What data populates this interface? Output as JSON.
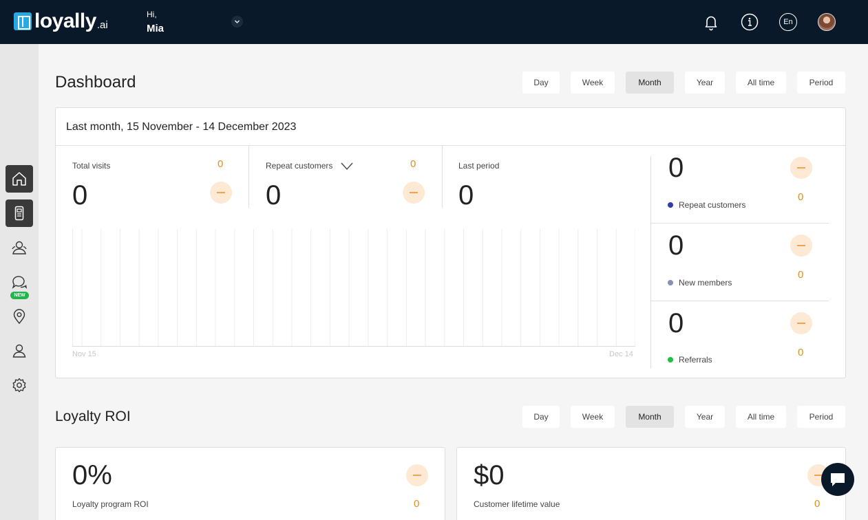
{
  "header": {
    "logo_text": "loyally",
    "logo_suffix": ".ai",
    "greeting": "Hi,",
    "user_name": "Mia",
    "language": "En",
    "icons": [
      "bell-icon",
      "info-icon",
      "chevron-down-icon"
    ]
  },
  "sidebar": {
    "items": [
      {
        "icon": "home-icon",
        "active": true
      },
      {
        "icon": "device-icon",
        "active": true
      },
      {
        "icon": "customers-icon",
        "active": false
      },
      {
        "icon": "chat-icon",
        "active": false,
        "badge": "NEW"
      },
      {
        "icon": "location-pin-icon",
        "active": false
      },
      {
        "icon": "user-icon",
        "active": false
      },
      {
        "icon": "gear-icon",
        "active": false
      }
    ]
  },
  "dashboard": {
    "title": "Dashboard",
    "periods": [
      "Day",
      "Week",
      "Month",
      "Year",
      "All time",
      "Period"
    ],
    "selected_period": "Month",
    "range_title": "Last month, 15 November - 14 December 2023",
    "metrics": {
      "total_visits": {
        "label": "Total visits",
        "value": "0",
        "delta": "0"
      },
      "repeat_customers": {
        "label": "Repeat customers",
        "value": "0",
        "delta": "0"
      },
      "last_period": {
        "label": "Last period",
        "value": "0"
      }
    },
    "side_stats": [
      {
        "label": "Repeat customers",
        "value": "0",
        "delta": "0",
        "color": "#2f3ea8"
      },
      {
        "label": "New members",
        "value": "0",
        "delta": "0",
        "color": "#8a90b4"
      },
      {
        "label": "Referrals",
        "value": "0",
        "delta": "0",
        "color": "#1fc13f"
      }
    ]
  },
  "chart_data": {
    "type": "bar",
    "x_start_label": "Nov 15",
    "x_end_label": "Dec 14",
    "categories_count": 30,
    "values": [
      0,
      0,
      0,
      0,
      0,
      0,
      0,
      0,
      0,
      0,
      0,
      0,
      0,
      0,
      0,
      0,
      0,
      0,
      0,
      0,
      0,
      0,
      0,
      0,
      0,
      0,
      0,
      0,
      0,
      0
    ],
    "grid": true
  },
  "roi": {
    "title": "Loyalty ROI",
    "periods": [
      "Day",
      "Week",
      "Month",
      "Year",
      "All time",
      "Period"
    ],
    "selected_period": "Month",
    "cards": [
      {
        "value": "0%",
        "label": "Loyalty program ROI",
        "delta": "0"
      },
      {
        "value": "$0",
        "label": "Customer lifetime value",
        "delta": "0"
      }
    ]
  }
}
